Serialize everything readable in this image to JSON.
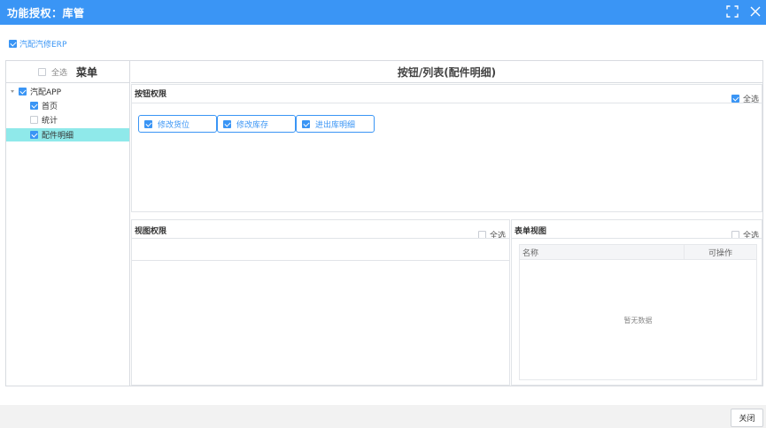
{
  "window": {
    "title": "功能授权：库管"
  },
  "erp": {
    "label": "汽配汽修ERP",
    "checked": true
  },
  "menu": {
    "select_all": "全选",
    "heading": "菜单",
    "tree": [
      {
        "label": "汽配APP",
        "checked": true,
        "level": 0,
        "expanded": true
      },
      {
        "label": "首页",
        "checked": true,
        "level": 1
      },
      {
        "label": "统计",
        "checked": false,
        "level": 1
      },
      {
        "label": "配件明细",
        "checked": true,
        "level": 1,
        "selected": true
      }
    ]
  },
  "right": {
    "heading": "按钮/列表(配件明细)"
  },
  "buttons_section": {
    "title": "按钮权限",
    "select_all": "全选",
    "select_all_checked": true,
    "items": [
      {
        "label": "修改货位",
        "checked": true
      },
      {
        "label": "修改库存",
        "checked": true
      },
      {
        "label": "进出库明细",
        "checked": true
      }
    ]
  },
  "view_section": {
    "title": "视图权限",
    "select_all": "全选",
    "select_all_checked": false
  },
  "form_section": {
    "title": "表单视图",
    "select_all": "全选",
    "select_all_checked": false,
    "columns": [
      "名称",
      "可操作"
    ],
    "empty_text": "暂无数据"
  },
  "footer": {
    "close_label": "关闭"
  },
  "colors": {
    "accent": "#3a95f5",
    "selected_row": "#8fe9ea"
  }
}
